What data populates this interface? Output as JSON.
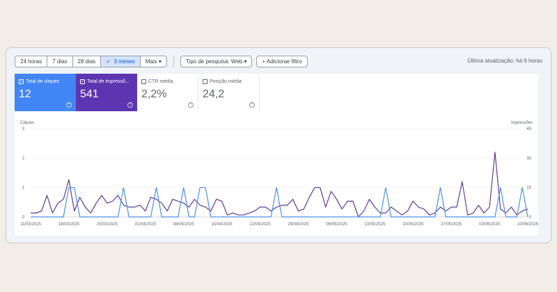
{
  "toolbar": {
    "ranges": [
      "24 horas",
      "7 dias",
      "28 dias",
      "3 meses"
    ],
    "selected_check": "✓",
    "more": "Mais",
    "search_type": "Tipo de pesquisa: Web",
    "add_filter": "Adicionar filtro",
    "last_update": "Última atualização: há 9 horas"
  },
  "metrics": [
    {
      "label": "Total de cliques",
      "value": "12",
      "checked": true,
      "color": "#4285f4"
    },
    {
      "label": "Total de impressõ...",
      "value": "541",
      "checked": true,
      "color": "#5e35b1"
    },
    {
      "label": "CTR média",
      "value": "2,2%",
      "checked": false
    },
    {
      "label": "Posição média",
      "value": "24,2",
      "checked": false
    }
  ],
  "chart_data": {
    "type": "line",
    "left_axis_label": "Cliques",
    "right_axis_label": "Impressões",
    "left_ylim": [
      0,
      3
    ],
    "left_ticks": [
      "0",
      "1",
      "2",
      "3"
    ],
    "right_ylim": [
      0,
      45
    ],
    "right_ticks": [
      "0",
      "15",
      "30",
      "45"
    ],
    "x_tick_labels": [
      "11/03/2025",
      "18/03/2025",
      "25/03/2025",
      "01/04/2025",
      "08/04/2025",
      "15/04/2025",
      "22/04/2025",
      "29/04/2025",
      "06/05/2025",
      "13/05/2025",
      "20/05/2025",
      "27/05/2025",
      "03/06/2025",
      "10/06/2025"
    ],
    "x_start": "11/03/2025",
    "x_end": "10/06/2025",
    "grid": true,
    "series": [
      {
        "name": "Cliques",
        "axis": "left",
        "color": "#4a8fe7",
        "values": [
          0,
          0,
          0,
          0,
          0,
          0,
          0,
          1,
          1,
          0,
          0,
          0,
          0,
          0,
          0,
          0,
          0,
          1,
          0,
          0,
          0,
          0,
          0,
          1,
          0,
          0,
          0,
          0,
          1,
          0,
          0,
          1,
          1,
          0,
          0,
          0,
          0,
          0,
          0,
          0,
          0,
          0,
          0,
          0,
          0,
          1,
          0,
          0,
          0,
          0,
          0,
          0,
          0,
          0,
          0,
          0,
          0,
          0,
          0,
          0,
          0,
          0,
          0,
          0,
          0,
          1,
          0,
          0,
          0,
          0,
          0,
          0,
          0,
          0,
          0,
          1,
          0,
          0,
          0,
          0,
          0,
          0,
          0,
          0,
          0,
          0,
          1,
          0,
          0,
          0,
          1,
          0
        ]
      },
      {
        "name": "Impressões",
        "axis": "right",
        "color": "#5b3a9a",
        "values": [
          2,
          2,
          3,
          11,
          2,
          7,
          9,
          19,
          3,
          10,
          5,
          2,
          7,
          11,
          7,
          8,
          11,
          6,
          5,
          5,
          6,
          3,
          10,
          9,
          7,
          3,
          9,
          8,
          7,
          5,
          9,
          6,
          5,
          3,
          9,
          8,
          1,
          2,
          1,
          1,
          2,
          3,
          5,
          5,
          3,
          5,
          6,
          6,
          9,
          3,
          4,
          10,
          15,
          15,
          5,
          13,
          9,
          4,
          8,
          8,
          0,
          3,
          9,
          5,
          2,
          2,
          5,
          3,
          1,
          3,
          8,
          5,
          4,
          1,
          2,
          5,
          3,
          5,
          5,
          18,
          1,
          2,
          6,
          2,
          5,
          33,
          4,
          2,
          5,
          1,
          3,
          4
        ]
      }
    ]
  }
}
